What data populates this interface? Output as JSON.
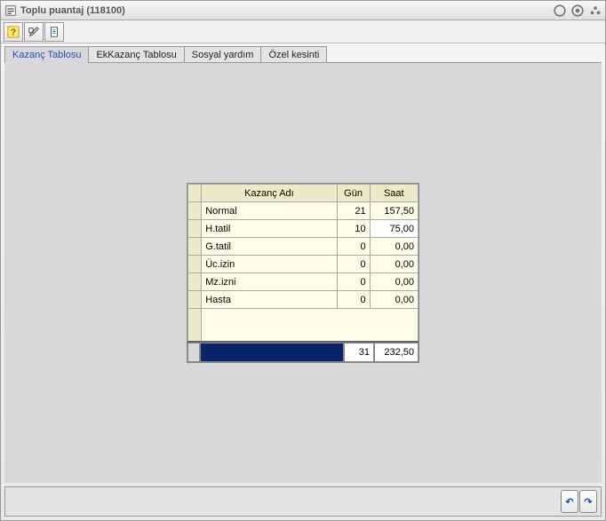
{
  "window": {
    "title": "Toplu puantaj (118100)"
  },
  "tabs": [
    {
      "label": "Kazanç Tablosu",
      "active": true
    },
    {
      "label": "EkKazanç Tablosu",
      "active": false
    },
    {
      "label": "Sosyal yardım",
      "active": false
    },
    {
      "label": "Özel kesinti",
      "active": false
    }
  ],
  "grid": {
    "headers": {
      "name": "Kazanç Adı",
      "gun": "Gün",
      "saat": "Saat"
    },
    "rows": [
      {
        "name": "Normal",
        "gun": "21",
        "saat": "157,50",
        "saat_edit": false
      },
      {
        "name": "H.tatil",
        "gun": "10",
        "saat": "75,00",
        "saat_edit": true
      },
      {
        "name": "G.tatil",
        "gun": "0",
        "saat": "0,00",
        "saat_edit": false
      },
      {
        "name": "Üc.izin",
        "gun": "0",
        "saat": "0,00",
        "saat_edit": false
      },
      {
        "name": "Mz.izni",
        "gun": "0",
        "saat": "0,00",
        "saat_edit": false
      },
      {
        "name": "Hasta",
        "gun": "0",
        "saat": "0,00",
        "saat_edit": false
      }
    ],
    "totals": {
      "gun": "31",
      "saat": "232,50"
    }
  }
}
